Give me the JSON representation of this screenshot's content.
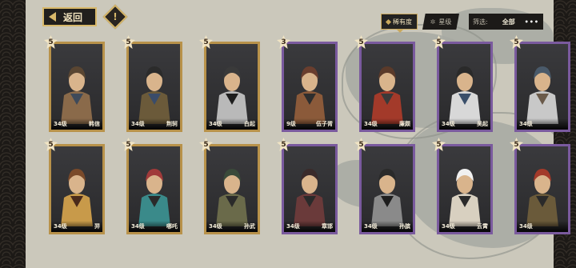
{
  "header": {
    "back_label": "返回",
    "info_symbol": "!",
    "sort_rarity_label": "稀有度",
    "sort_star_label": "星级",
    "filter_label": "筛选:",
    "filter_value": "全部",
    "more_label": "•••"
  },
  "colors": {
    "gold_frame": "#b8924a",
    "purple_frame": "#7a5a9e",
    "background_map": "#cbc8bb"
  },
  "cards": [
    {
      "name": "韩信",
      "level": "34级",
      "stars": "5",
      "rarity": "gold"
    },
    {
      "name": "荆轲",
      "level": "34级",
      "stars": "5",
      "rarity": "gold"
    },
    {
      "name": "白起",
      "level": "34级",
      "stars": "5",
      "rarity": "gold"
    },
    {
      "name": "伍子胥",
      "level": "9级",
      "stars": "3",
      "rarity": "purple"
    },
    {
      "name": "廉颇",
      "level": "34级",
      "stars": "5",
      "rarity": "purple"
    },
    {
      "name": "吴起",
      "level": "34级",
      "stars": "5",
      "rarity": "purple"
    },
    {
      "name": "",
      "level": "34级",
      "stars": "5",
      "rarity": "purple"
    },
    {
      "name": "羿",
      "level": "34级",
      "stars": "5",
      "rarity": "gold"
    },
    {
      "name": "哪吒",
      "level": "34级",
      "stars": "5",
      "rarity": "gold"
    },
    {
      "name": "孙武",
      "level": "34级",
      "stars": "5",
      "rarity": "gold"
    },
    {
      "name": "章邯",
      "level": "34级",
      "stars": "5",
      "rarity": "purple"
    },
    {
      "name": "孙膑",
      "level": "34级",
      "stars": "5",
      "rarity": "purple"
    },
    {
      "name": "云霄",
      "level": "34级",
      "stars": "5",
      "rarity": "purple"
    },
    {
      "name": "",
      "level": "34级",
      "stars": "5",
      "rarity": "purple"
    }
  ]
}
